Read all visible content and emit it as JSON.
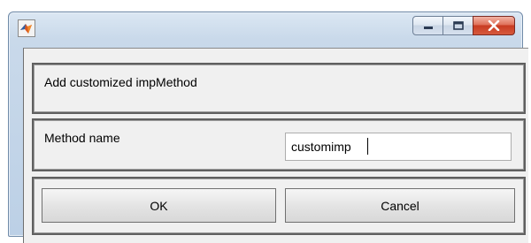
{
  "window": {
    "title": "",
    "icon": "matlab-logo-icon",
    "controls": {
      "minimize_icon": "minimize-icon",
      "maximize_icon": "maximize-icon",
      "close_icon": "close-icon"
    },
    "accent_colors": {
      "frame": "#bcd0e6",
      "close_button": "#c83c22",
      "client_background": "#f0f0f0"
    }
  },
  "dialog": {
    "header_text": "Add customized impMethod",
    "method_name_label": "Method name",
    "method_name_value": "customimp",
    "ok_label": "OK",
    "cancel_label": "Cancel"
  }
}
